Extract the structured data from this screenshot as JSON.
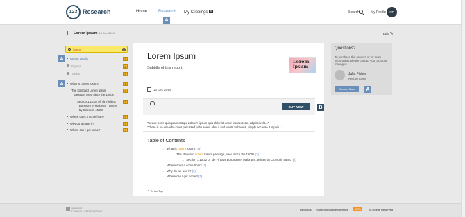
{
  "header": {
    "logo_number": "123",
    "logo_text": "Research",
    "nav": [
      {
        "label": "Home"
      },
      {
        "label": "Research"
      },
      {
        "label": "My Clippings",
        "badge": "5"
      }
    ],
    "search_label": "Search",
    "profile_label": "My Profile",
    "avatar_initials": "NP",
    "research_marker": "A"
  },
  "breadcrumb": {
    "title": "Lorem Ipsum",
    "date": "13 Dec 2019",
    "edit_label": "Edit"
  },
  "sidebar": {
    "search_value": "lorem",
    "clear_icon": "×",
    "marker_a": "A",
    "items": [
      {
        "label": "Report details",
        "badge": "2"
      },
      {
        "label": "Figures",
        "badge": "2"
      },
      {
        "label": "Tables",
        "badge": "2"
      }
    ],
    "toc": [
      {
        "label": "What is Lorem Ipsum?",
        "badge": "4"
      },
      {
        "label": "The standard Lorem Ipsum",
        "badge": "3"
      },
      {
        "label": "passage, used since the 1500s",
        "badge": ""
      },
      {
        "label": "Section 1.10.32 of \"de Finibus",
        "badge": "2"
      },
      {
        "label": "Bonorum et Malorum\", written",
        "badge": ""
      },
      {
        "label": "by Cicero in 45 BC",
        "badge": ""
      },
      {
        "label": "Where does it come from?",
        "badge": "2"
      },
      {
        "label": "Why do we use it?",
        "badge": "2"
      },
      {
        "label": "Where can I get some?",
        "badge": "2"
      }
    ]
  },
  "main": {
    "title": "Lorem Ipsum",
    "subtitle": "Subtitle of this report",
    "cover_text_1": "Lorem",
    "cover_text_2": "ipsum",
    "date": "13 Dec 2019",
    "buy_label": "BUY NOW",
    "b_marker": "B",
    "quote_1": "\"Neque porro quisquam est qui dolorem ipsum quia dolor sit amet, consectetur, adipisci velit...\"",
    "quote_2": "\"There is no one who loves pain itself, who seeks after it and wants to have it, simply because it is pain...\"",
    "toc_title": "Table of Contents",
    "toc": [
      {
        "pre": "What is ",
        "hl": "Lorem",
        "post": " Ipsum?",
        "pg": "(4)"
      },
      {
        "pre": "The standard ",
        "hl": "Lorem",
        "post": " Ipsum passage, used since the 1500s",
        "pg": "(3)"
      },
      {
        "pre": "Section 1.10.32 of \"de Finibus Bonorum et Malorum\", written by Cicero in 45 BC",
        "hl": "",
        "post": "",
        "pg": "(2)"
      },
      {
        "pre": "Where does it come from?",
        "hl": "",
        "post": "",
        "pg": "(2)"
      },
      {
        "pre": "Why do we use it?",
        "hl": "",
        "post": "",
        "pg": "(1)"
      },
      {
        "pre": "Where can I get some?",
        "hl": "",
        "post": "",
        "pg": "(2)"
      }
    ],
    "to_top": "To the Top"
  },
  "questions": {
    "title": "Questions?",
    "text": "To purchase this product or for more information, please contact your account manager:",
    "name": "Julia Fisher",
    "role": "Regular Admin",
    "contact_label": "Contact Now",
    "marker_a": "A"
  },
  "footer": {
    "logo_small": "powered by",
    "logo_text": "PUBLISH INTERACTIVE",
    "links": [
      "Dev tools",
      "Switch to Mobile Interface",
      "Help"
    ],
    "badge": "BETA",
    "rights": "All Rights Reserved"
  },
  "colors": {
    "accent": "#2f4f66",
    "marker": "#6b8fb8",
    "highlight": "#fce96a",
    "badge": "#f0b42b"
  }
}
